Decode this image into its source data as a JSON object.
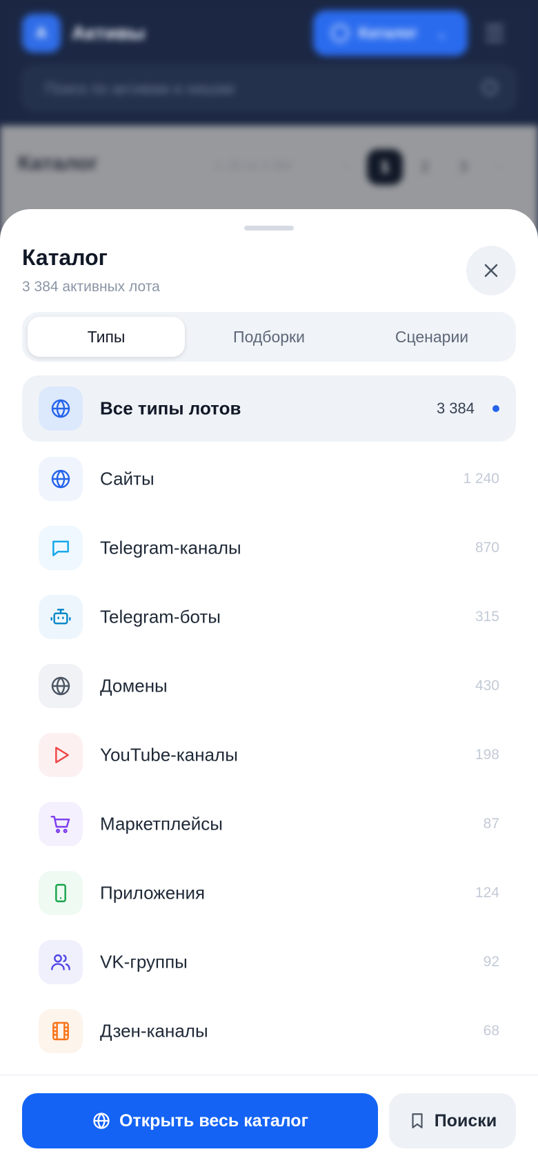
{
  "background": {
    "logo_letter": "A",
    "app_title": "Активы",
    "catalog_button": "Каталог",
    "search_placeholder": "Поиск по активам и нишам",
    "page_title": "Каталог",
    "range_text": "1–20 из 3 384",
    "pages": [
      "1",
      "2",
      "3"
    ],
    "active_page": "1"
  },
  "sheet": {
    "title": "Каталог",
    "subtitle": "3 384 активных лота",
    "tabs": [
      {
        "label": "Типы",
        "active": true
      },
      {
        "label": "Подборки",
        "active": false
      },
      {
        "label": "Сценарии",
        "active": false
      }
    ],
    "items": [
      {
        "label": "Все типы лотов",
        "count": "3 384",
        "icon": "globe-icon",
        "icon_color": "#2563eb",
        "icon_bg": "#dce8fb",
        "selected": true
      },
      {
        "label": "Сайты",
        "count": "1 240",
        "icon": "globe-icon",
        "icon_color": "#2563eb",
        "icon_bg": "#eff4fd"
      },
      {
        "label": "Telegram-каналы",
        "count": "870",
        "icon": "message-icon",
        "icon_color": "#0ea5e9",
        "icon_bg": "#eef8fe"
      },
      {
        "label": "Telegram-боты",
        "count": "315",
        "icon": "robot-icon",
        "icon_color": "#0284c7",
        "icon_bg": "#eef6fd"
      },
      {
        "label": "Домены",
        "count": "430",
        "icon": "globe-icon",
        "icon_color": "#4b5563",
        "icon_bg": "#f0f2f5"
      },
      {
        "label": "YouTube-каналы",
        "count": "198",
        "icon": "play-icon",
        "icon_color": "#ef4444",
        "icon_bg": "#fdf0f0"
      },
      {
        "label": "Маркетплейсы",
        "count": "87",
        "icon": "cart-icon",
        "icon_color": "#7c3aed",
        "icon_bg": "#f4f0fd"
      },
      {
        "label": "Приложения",
        "count": "124",
        "icon": "smartphone-icon",
        "icon_color": "#16a34a",
        "icon_bg": "#eefaf2"
      },
      {
        "label": "VK-группы",
        "count": "92",
        "icon": "users-icon",
        "icon_color": "#4f46e5",
        "icon_bg": "#f0f0fd"
      },
      {
        "label": "Дзен-каналы",
        "count": "68",
        "icon": "film-icon",
        "icon_color": "#f97316",
        "icon_bg": "#fdf4ec"
      }
    ],
    "open_catalog_button": "Открыть весь каталог",
    "saved_searches_button": "Поиски"
  }
}
